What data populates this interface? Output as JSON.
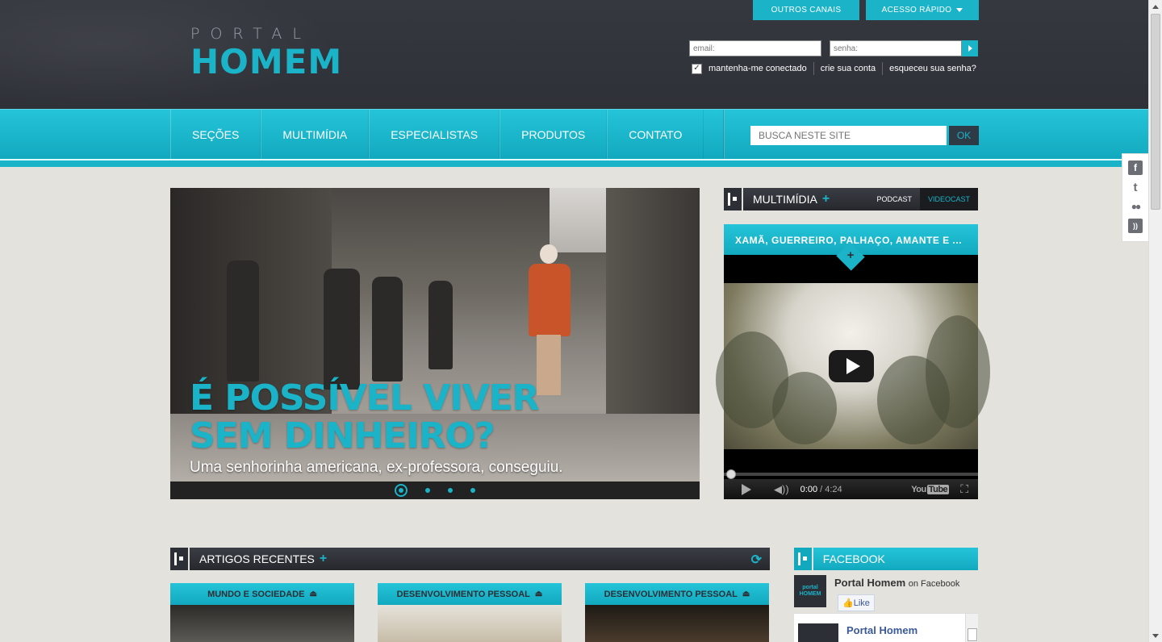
{
  "header": {
    "logo_top": "PORTAL",
    "logo_main": "HOMEM",
    "outros_canais": "OUTROS CANAIS",
    "acesso_rapido": "ACESSO RÁPIDO",
    "email_placeholder": "email:",
    "senha_placeholder": "senha:",
    "remember": "mantenha-me conectado",
    "create_account": "crie sua conta",
    "forgot": "esqueceu sua senha?"
  },
  "nav": {
    "items": [
      "SEÇÕES",
      "MULTIMÍDIA",
      "ESPECIALISTAS",
      "PRODUTOS",
      "CONTATO"
    ],
    "search_placeholder": "BUSCA NESTE SITE",
    "search_button": "OK"
  },
  "social": [
    "facebook-icon",
    "twitter-icon",
    "flickr-icon",
    "rss-icon"
  ],
  "slider": {
    "title_line1": "É POSSÍVEL VIVER",
    "title_line2": "SEM DINHEIRO?",
    "subtitle": "Uma senhorinha americana, ex-professora, conseguiu.",
    "slide_count": 4,
    "active_slide": 1
  },
  "multimidia": {
    "heading": "MULTIMÍDIA",
    "tabs": [
      "PODCAST",
      "VIDEOCAST"
    ],
    "active_tab": "VIDEOCAST",
    "video_title": "XAMÃ, GUERREIRO, PALHAÇO, AMANTE E ...",
    "time_current": "0:00",
    "time_total": "/ 4:24",
    "youtube_label": "You",
    "youtube_tube": "Tube"
  },
  "artigos": {
    "heading": "ARTIGOS RECENTES",
    "cards": [
      {
        "category": "MUNDO E SOCIEDADE"
      },
      {
        "category": "DESENVOLVIMENTO PESSOAL"
      },
      {
        "category": "DESENVOLVIMENTO PESSOAL"
      }
    ]
  },
  "facebook": {
    "heading": "FACEBOOK",
    "page_name": "Portal Homem",
    "on_facebook": "on Facebook",
    "like": "Like",
    "logo_small_top": "portal",
    "logo_small_main": "HOMEM",
    "list_name": "Portal Homem"
  },
  "colors": {
    "accent": "#1ab3c8",
    "header_bg": "#33353c",
    "page_bg": "#e4e2dd"
  }
}
